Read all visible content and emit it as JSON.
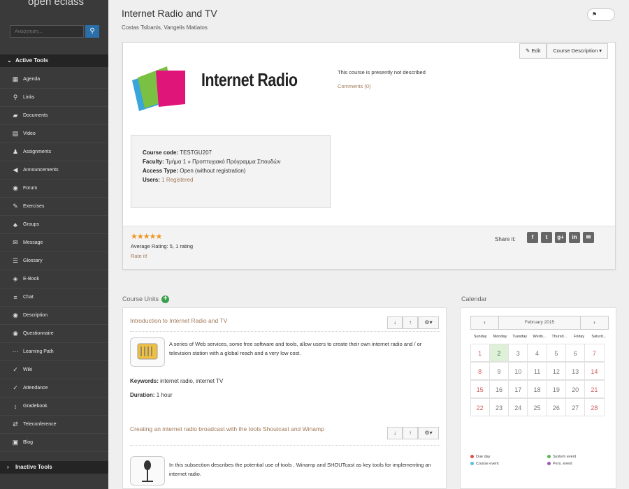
{
  "sidebar": {
    "logo": "open eclass",
    "search_placeholder": "Αναζήτηση...",
    "active_tools_label": "Active Tools",
    "inactive_tools_label": "Inactive Tools",
    "items": [
      {
        "label": "Agenda",
        "icon": "calendar-icon",
        "glyph": "▦"
      },
      {
        "label": "Links",
        "icon": "link-icon",
        "glyph": "⚲"
      },
      {
        "label": "Documents",
        "icon": "folder-icon",
        "glyph": "▰"
      },
      {
        "label": "Video",
        "icon": "film-icon",
        "glyph": "▤"
      },
      {
        "label": "Assignments",
        "icon": "flask-icon",
        "glyph": "♟"
      },
      {
        "label": "Announcements",
        "icon": "bullhorn-icon",
        "glyph": "◀"
      },
      {
        "label": "Forum",
        "icon": "comments-icon",
        "glyph": "◉"
      },
      {
        "label": "Exercises",
        "icon": "pencil-icon",
        "glyph": "✎"
      },
      {
        "label": "Groups",
        "icon": "users-icon",
        "glyph": "♣"
      },
      {
        "label": "Message",
        "icon": "envelope-icon",
        "glyph": "✉"
      },
      {
        "label": "Glossary",
        "icon": "list-icon",
        "glyph": "☰"
      },
      {
        "label": "E-Book",
        "icon": "book-icon",
        "glyph": "◈"
      },
      {
        "label": "Chat",
        "icon": "chat-icon",
        "glyph": "≡"
      },
      {
        "label": "Description",
        "icon": "info-icon",
        "glyph": "◉"
      },
      {
        "label": "Questionnaire",
        "icon": "question-icon",
        "glyph": "◉"
      },
      {
        "label": "Learning Path",
        "icon": "ellipsis-icon",
        "glyph": "⋯"
      },
      {
        "label": "Wiki",
        "icon": "wiki-icon",
        "glyph": "✓"
      },
      {
        "label": "Attendance",
        "icon": "check-icon",
        "glyph": "✓"
      },
      {
        "label": "Gradebook",
        "icon": "sort-icon",
        "glyph": "↕"
      },
      {
        "label": "Teleconference",
        "icon": "exchange-icon",
        "glyph": "⇄"
      },
      {
        "label": "Blog",
        "icon": "blog-icon",
        "glyph": "▣"
      }
    ]
  },
  "header": {
    "title": "Internet Radio and TV",
    "authors": "Costas Tsibanis, Vangelis Matiatos",
    "toggle_icon": "flag-icon"
  },
  "course": {
    "logo_text": "Internet Radio",
    "edit_label": "Edit",
    "description_button": "Course Description",
    "not_described": "This course is presently not described",
    "comments": "Comments (0)",
    "code_label": "Course code:",
    "code_value": "TESTGU207",
    "faculty_label": "Faculty:",
    "faculty_value": "Τμήμα 1 » Προπτυχιακό Πρόγραμμα Σπουδών",
    "access_label": "Access Type:",
    "access_value": "Open (without registration)",
    "users_label": "Users:",
    "users_value": "1 Registered",
    "stars": "★★★★★",
    "rating_text": "Average Rating: 5, 1 rating",
    "rate_it": "Rate it!",
    "share_label": "Share it:",
    "share_icons": [
      {
        "name": "facebook-icon",
        "glyph": "f"
      },
      {
        "name": "twitter-icon",
        "glyph": "t"
      },
      {
        "name": "google-plus-icon",
        "glyph": "g+"
      },
      {
        "name": "linkedin-icon",
        "glyph": "in"
      },
      {
        "name": "email-icon",
        "glyph": "✉"
      }
    ]
  },
  "units": {
    "label": "Course Units",
    "items": [
      {
        "title": "Introduction to Internet Radio and TV",
        "description": "A series of Web services, some free software and tools, allow users to create their own internet radio and / or television station with a global reach and a very low cost.",
        "keywords_label": "Keywords:",
        "keywords": "internet radio, internet TV",
        "duration_label": "Duration:",
        "duration": "1 hour"
      },
      {
        "title": "Creating an internet radio broadcast with the tools Shoutcast and Winamp",
        "description": "In this subsection describes the potential use of tools , Winamp and SHOUTcast as key tools for implementing an internet radio."
      }
    ]
  },
  "calendar": {
    "label": "Calendar",
    "month": "February 2015",
    "days": [
      "Sunday",
      "Monday",
      "Tuesday",
      "Wedn...",
      "Thursd...",
      "Friday",
      "Saturd..."
    ],
    "weeks": [
      [
        "1",
        "2",
        "3",
        "4",
        "5",
        "6",
        "7"
      ],
      [
        "8",
        "9",
        "10",
        "11",
        "12",
        "13",
        "14"
      ],
      [
        "15",
        "16",
        "17",
        "18",
        "19",
        "20",
        "21"
      ],
      [
        "22",
        "23",
        "24",
        "25",
        "26",
        "27",
        "28"
      ]
    ],
    "legend": [
      {
        "label": "Due day",
        "color": "#d9534f"
      },
      {
        "label": "System event",
        "color": "#5cb85c"
      },
      {
        "label": "Course event",
        "color": "#5bc0de"
      },
      {
        "label": "Pers. event",
        "color": "#9b59b6"
      }
    ]
  }
}
